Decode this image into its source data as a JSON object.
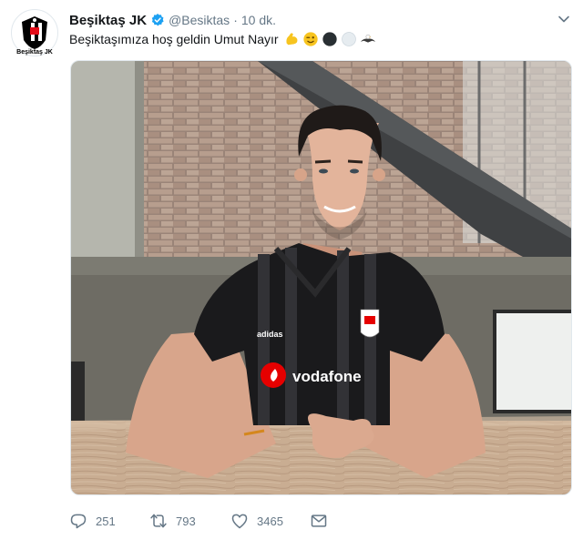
{
  "tweet": {
    "avatar_caption": "Beşiktaş JK",
    "author_name": "Beşiktaş JK",
    "handle": "@Besiktas",
    "separator": "·",
    "time": "10 dk.",
    "text": "Beşiktaşımıza hoş geldin Umut Nayır",
    "emojis": [
      "flexed-biceps",
      "winking-face",
      "black-circle",
      "white-circle",
      "eagle"
    ]
  },
  "media": {
    "jersey_sponsor": "vodafone",
    "jersey_brand": "adidas"
  },
  "actions": {
    "reply_count": "251",
    "retweet_count": "793",
    "like_count": "3465"
  },
  "colors": {
    "accent": "#1da1f2",
    "muted": "#657786",
    "text": "#14171a"
  }
}
